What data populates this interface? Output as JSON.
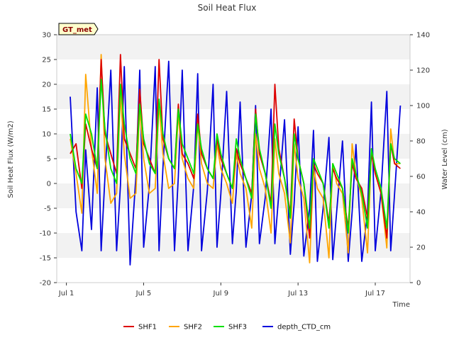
{
  "chart_data": {
    "type": "line",
    "title": "Soil Heat Flux",
    "xlabel": "Time",
    "ylabel": "Soil Heat Flux (W/m2)",
    "y2label": "Water Level (cm)",
    "badge": "GT_met",
    "x_unit": "date (July)",
    "xlim": [
      0.5,
      18.8
    ],
    "ylim": [
      -20,
      30
    ],
    "y2lim": [
      0,
      140
    ],
    "x_ticks": [
      1,
      5,
      9,
      13,
      17
    ],
    "x_tick_labels": [
      "Jul 1",
      "Jul 5",
      "Jul 9",
      "Jul 13",
      "Jul 17"
    ],
    "y_ticks": [
      -20,
      -15,
      -10,
      -5,
      0,
      5,
      10,
      15,
      20,
      25,
      30
    ],
    "y2_ticks": [
      0,
      20,
      40,
      60,
      80,
      100,
      120,
      140
    ],
    "grid": false,
    "banded_background": true,
    "legend_position": "bottom",
    "series": [
      {
        "name": "SHF1",
        "axis": "left",
        "color": "#dd0000",
        "x": [
          1.2,
          1.5,
          1.8,
          2.0,
          2.3,
          2.6,
          2.8,
          3.0,
          3.3,
          3.6,
          3.8,
          4.0,
          4.3,
          4.6,
          4.8,
          5.0,
          5.3,
          5.6,
          5.8,
          6.0,
          6.3,
          6.6,
          6.8,
          7.0,
          7.3,
          7.6,
          7.8,
          8.0,
          8.3,
          8.6,
          8.8,
          9.0,
          9.3,
          9.6,
          9.8,
          10.0,
          10.3,
          10.6,
          10.8,
          11.0,
          11.3,
          11.6,
          11.8,
          12.0,
          12.3,
          12.6,
          12.8,
          13.0,
          13.3,
          13.6,
          13.8,
          14.0,
          14.3,
          14.6,
          14.8,
          15.0,
          15.3,
          15.6,
          15.8,
          16.0,
          16.3,
          16.6,
          16.8,
          17.0,
          17.3,
          17.6,
          17.8,
          18.0,
          18.3
        ],
        "values": [
          6,
          8,
          -1,
          12,
          7,
          3,
          25,
          10,
          6,
          2,
          26,
          9,
          6,
          3,
          19,
          8,
          5,
          2,
          25,
          9,
          5,
          3,
          16,
          6,
          4,
          1,
          14,
          6,
          3,
          1,
          9,
          5,
          2,
          -1,
          7,
          4,
          1,
          -2,
          15,
          6,
          2,
          -4,
          20,
          7,
          1,
          -6,
          13,
          5,
          0,
          -11,
          4,
          2,
          0,
          -8,
          3,
          1,
          -1,
          -9,
          4,
          1,
          -1,
          -7,
          6,
          2,
          -2,
          -11,
          8,
          4,
          3
        ]
      },
      {
        "name": "SHF2",
        "axis": "left",
        "color": "#ffa500",
        "x": [
          1.2,
          1.5,
          1.8,
          2.0,
          2.3,
          2.6,
          2.8,
          3.0,
          3.3,
          3.6,
          3.8,
          4.0,
          4.3,
          4.6,
          4.8,
          5.0,
          5.3,
          5.6,
          5.8,
          6.0,
          6.3,
          6.6,
          6.8,
          7.0,
          7.3,
          7.6,
          7.8,
          8.0,
          8.3,
          8.6,
          8.8,
          9.0,
          9.3,
          9.6,
          9.8,
          10.0,
          10.3,
          10.6,
          10.8,
          11.0,
          11.3,
          11.6,
          11.8,
          12.0,
          12.3,
          12.6,
          12.8,
          13.0,
          13.3,
          13.6,
          13.8,
          14.0,
          14.3,
          14.6,
          14.8,
          15.0,
          15.3,
          15.6,
          15.8,
          16.0,
          16.3,
          16.6,
          16.8,
          17.0,
          17.3,
          17.6,
          17.8,
          18.0,
          18.3
        ],
        "values": [
          9,
          2,
          -6,
          22,
          7,
          -2,
          26,
          5,
          -4,
          -2,
          18,
          6,
          -3,
          -2,
          15,
          5,
          -2,
          -1,
          16,
          6,
          -1,
          0,
          14,
          5,
          1,
          -1,
          12,
          4,
          0,
          -1,
          8,
          3,
          0,
          -4,
          6,
          2,
          -1,
          -9,
          10,
          3,
          -1,
          -10,
          9,
          2,
          -2,
          -12,
          8,
          1,
          -3,
          -16,
          3,
          -1,
          -3,
          -15,
          4,
          0,
          -2,
          -14,
          8,
          2,
          -3,
          -14,
          7,
          2,
          -2,
          -13,
          11,
          4,
          4
        ]
      },
      {
        "name": "SHF3",
        "axis": "left",
        "color": "#00e000",
        "x": [
          1.2,
          1.5,
          1.8,
          2.0,
          2.3,
          2.6,
          2.8,
          3.0,
          3.3,
          3.6,
          3.8,
          4.0,
          4.3,
          4.6,
          4.8,
          5.0,
          5.3,
          5.6,
          5.8,
          6.0,
          6.3,
          6.6,
          6.8,
          7.0,
          7.3,
          7.6,
          7.8,
          8.0,
          8.3,
          8.6,
          8.8,
          9.0,
          9.3,
          9.6,
          9.8,
          10.0,
          10.3,
          10.6,
          10.8,
          11.0,
          11.3,
          11.6,
          11.8,
          12.0,
          12.3,
          12.6,
          12.8,
          13.0,
          13.3,
          13.6,
          13.8,
          14.0,
          14.3,
          14.6,
          14.8,
          15.0,
          15.3,
          15.6,
          15.8,
          16.0,
          16.3,
          16.6,
          16.8,
          17.0,
          17.3,
          17.6,
          17.8,
          18.0,
          18.3
        ],
        "values": [
          10,
          3,
          0,
          14,
          10,
          3,
          21,
          11,
          3,
          0,
          20,
          12,
          5,
          2,
          16,
          9,
          4,
          2,
          17,
          10,
          5,
          3,
          15,
          8,
          5,
          2,
          12,
          7,
          3,
          1,
          10,
          6,
          2,
          -1,
          9,
          5,
          1,
          -3,
          14,
          7,
          2,
          -5,
          12,
          6,
          1,
          -7,
          10,
          5,
          0,
          -9,
          5,
          3,
          0,
          -9,
          4,
          2,
          -1,
          -10,
          5,
          2,
          -2,
          -9,
          7,
          3,
          -1,
          -9,
          8,
          5,
          4
        ]
      },
      {
        "name": "depth_CTD_cm",
        "axis": "right",
        "color": "#0000dd",
        "x": [
          1.2,
          1.5,
          1.8,
          2.0,
          2.3,
          2.6,
          2.8,
          3.0,
          3.3,
          3.6,
          3.8,
          4.0,
          4.3,
          4.6,
          4.8,
          5.0,
          5.3,
          5.6,
          5.8,
          6.0,
          6.3,
          6.6,
          6.8,
          7.0,
          7.3,
          7.6,
          7.8,
          8.0,
          8.3,
          8.6,
          8.8,
          9.0,
          9.3,
          9.6,
          9.8,
          10.0,
          10.3,
          10.6,
          10.8,
          11.0,
          11.3,
          11.6,
          11.8,
          12.0,
          12.3,
          12.6,
          12.8,
          13.0,
          13.3,
          13.6,
          13.8,
          14.0,
          14.3,
          14.6,
          14.8,
          15.0,
          15.3,
          15.6,
          15.8,
          16.0,
          16.3,
          16.6,
          16.8,
          17.0,
          17.3,
          17.6,
          17.8,
          18.0,
          18.3
        ],
        "values": [
          105,
          40,
          18,
          75,
          30,
          110,
          18,
          60,
          120,
          18,
          55,
          122,
          10,
          60,
          120,
          20,
          55,
          122,
          18,
          65,
          125,
          18,
          60,
          120,
          18,
          55,
          118,
          18,
          52,
          112,
          20,
          50,
          108,
          22,
          52,
          102,
          20,
          50,
          100,
          22,
          48,
          98,
          22,
          50,
          92,
          16,
          45,
          88,
          15,
          42,
          86,
          12,
          42,
          82,
          13,
          40,
          80,
          12,
          40,
          78,
          12,
          40,
          102,
          18,
          52,
          108,
          18,
          50,
          100
        ]
      }
    ]
  }
}
